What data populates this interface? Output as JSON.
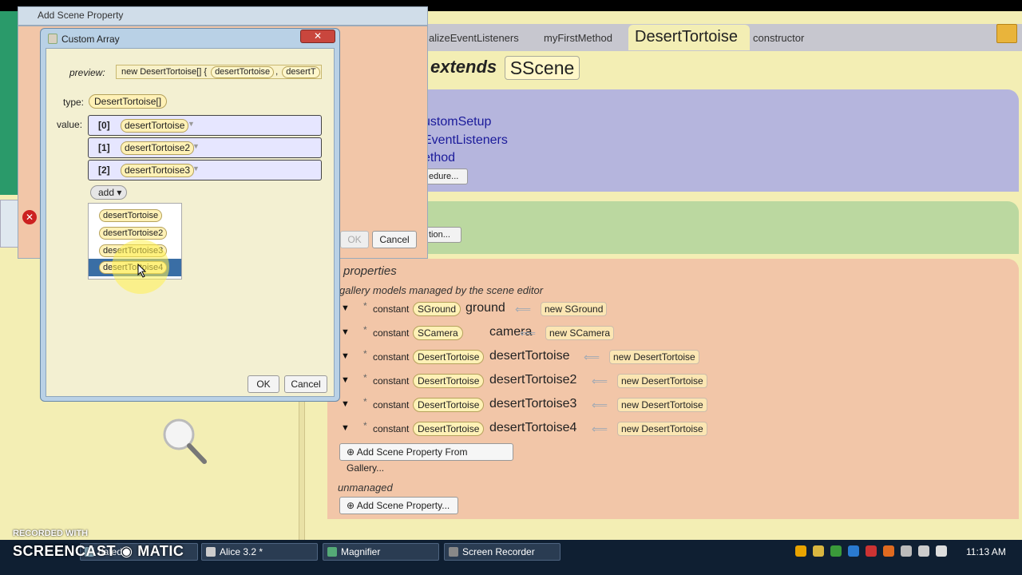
{
  "ide": {
    "tabs": [
      "alizeEventListeners",
      "myFirstMethod",
      "constructor"
    ],
    "active_tab": "DesertTortoise",
    "extends_keyword": "extends",
    "superclass": "SScene",
    "methods": [
      "ustomSetup",
      "EventListeners",
      "ethod"
    ],
    "edure_button": "edure...",
    "tion_button": "tion...",
    "properties_heading": "properties",
    "gallery_note": "gallery models managed by the scene editor",
    "properties": [
      {
        "modifier": "constant",
        "type": "SGround",
        "name": "ground",
        "new_kw": "new",
        "new_type": "SGround"
      },
      {
        "modifier": "constant",
        "type": "SCamera",
        "name": "camera",
        "new_kw": "new",
        "new_type": "SCamera"
      },
      {
        "modifier": "constant",
        "type": "DesertTortoise",
        "name": "desertTortoise",
        "new_kw": "new",
        "new_type": "DesertTortoise"
      },
      {
        "modifier": "constant",
        "type": "DesertTortoise",
        "name": "desertTortoise2",
        "new_kw": "new",
        "new_type": "DesertTortoise"
      },
      {
        "modifier": "constant",
        "type": "DesertTortoise",
        "name": "desertTortoise3",
        "new_kw": "new",
        "new_type": "DesertTortoise"
      },
      {
        "modifier": "constant",
        "type": "DesertTortoise",
        "name": "desertTortoise4",
        "new_kw": "new",
        "new_type": "DesertTortoise"
      }
    ],
    "add_from_gallery": "Add Scene Property From Gallery...",
    "unmanaged_label": "unmanaged",
    "add_scene_property": "Add Scene Property..."
  },
  "add_scene_property_dialog": {
    "title": "Add Scene Property",
    "ok": "OK",
    "cancel": "Cancel"
  },
  "custom_array_dialog": {
    "title": "Custom Array",
    "close": "✕",
    "preview_label": "preview:",
    "preview_prefix": "new DesertTortoise[] {",
    "preview_items": [
      "desertTortoise",
      "desertT"
    ],
    "type_label": "type:",
    "type_value": "DesertTortoise[]",
    "value_label": "value:",
    "values": [
      {
        "index": "[0]",
        "value": "desertTortoise"
      },
      {
        "index": "[1]",
        "value": "desertTortoise2"
      },
      {
        "index": "[2]",
        "value": "desertTortoise3"
      }
    ],
    "add_button": "add ▾",
    "dropdown_options": [
      "desertTortoise",
      "desertTortoise2",
      "desertTortoise3",
      "desertTortoise4"
    ],
    "selected_option_index": 3,
    "ok": "OK",
    "cancel": "Cancel"
  },
  "watermark": {
    "line1": "RECORDED WITH",
    "line2": "SCREENCAST ◉ MATIC"
  },
  "taskbar": {
    "items": [
      "Alice 3.2 *",
      "Magnifier",
      "Screen Recorder"
    ],
    "hidden_item": "dated",
    "clock": "11:13 AM"
  }
}
